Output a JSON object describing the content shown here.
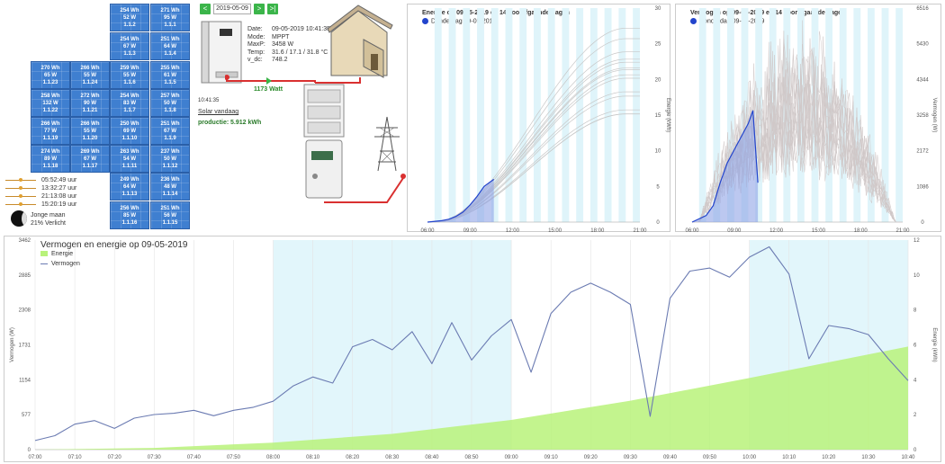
{
  "panels": [
    {
      "wh": "254 Wh",
      "w": "52 W",
      "id": "1.1.2"
    },
    {
      "wh": "271 Wh",
      "w": "95 W",
      "id": "1.1.1"
    },
    {
      "wh": "254 Wh",
      "w": "67 W",
      "id": "1.1.3"
    },
    {
      "wh": "251 Wh",
      "w": "64 W",
      "id": "1.1.4"
    },
    {
      "wh": "270 Wh",
      "w": "65 W",
      "id": "1.1.23"
    },
    {
      "wh": "266 Wh",
      "w": "55 W",
      "id": "1.1.24"
    },
    {
      "wh": "259 Wh",
      "w": "55 W",
      "id": "1.1.6"
    },
    {
      "wh": "255 Wh",
      "w": "61 W",
      "id": "1.1.5"
    },
    {
      "wh": "258 Wh",
      "w": "132 W",
      "id": "1.1.22"
    },
    {
      "wh": "272 Wh",
      "w": "90 W",
      "id": "1.1.21"
    },
    {
      "wh": "254 Wh",
      "w": "83 W",
      "id": "1.1.7"
    },
    {
      "wh": "257 Wh",
      "w": "50 W",
      "id": "1.1.8"
    },
    {
      "wh": "266 Wh",
      "w": "77 W",
      "id": "1.1.19"
    },
    {
      "wh": "266 Wh",
      "w": "55 W",
      "id": "1.1.20"
    },
    {
      "wh": "250 Wh",
      "w": "69 W",
      "id": "1.1.10"
    },
    {
      "wh": "251 Wh",
      "w": "67 W",
      "id": "1.1.9"
    },
    {
      "wh": "274 Wh",
      "w": "89 W",
      "id": "1.1.18"
    },
    {
      "wh": "269 Wh",
      "w": "67 W",
      "id": "1.1.17"
    },
    {
      "wh": "263 Wh",
      "w": "54 W",
      "id": "1.1.11"
    },
    {
      "wh": "237 Wh",
      "w": "50 W",
      "id": "1.1.12"
    },
    {
      "wh": "249 Wh",
      "w": "64 W",
      "id": "1.1.13"
    },
    {
      "wh": "236 Wh",
      "w": "48 W",
      "id": "1.1.14"
    },
    {
      "wh": "256 Wh",
      "w": "85 W",
      "id": "1.1.16"
    },
    {
      "wh": "251 Wh",
      "w": "56 W",
      "id": "1.1.15"
    }
  ],
  "sun": {
    "sunrise": "05:52:49 uur",
    "noon": "13:32:27 uur",
    "sunset": "21:13:08 uur",
    "daylength": "15:20:19 uur",
    "moon_phase": "Jonge maan",
    "moon_lit": "21% Verlicht"
  },
  "date_nav": {
    "prev": "<",
    "date": "2019-05-09",
    "next": ">",
    "last": ">|"
  },
  "inverter": {
    "date_label": "Date:",
    "date_value": "09-05-2019 10:41:35",
    "mode_label": "Mode:",
    "mode_value": "MPPT",
    "maxp_label": "MaxP:",
    "maxp_value": "3458 W",
    "temp_label": "Temp:",
    "temp_value": "31.6 / 17.1 / 31.8 °C",
    "vdc_label": "v_dc:",
    "vdc_value": "748.2",
    "time": "10:41:35",
    "power_flow": "1173 Watt",
    "solar_link": "Solar vandaag",
    "production_label": "productie:",
    "production_value": "5.912 kWh"
  },
  "chart_data": [
    {
      "type": "line",
      "title": "Energie op 09-05-2019 en 14 voorafgaande dagen",
      "legend": [
        "Donderdag 09-05-2019"
      ],
      "ylabel": "Energie (kWh)",
      "xticks": [
        "06:00",
        "09:00",
        "12:00",
        "15:00",
        "18:00",
        "21:00"
      ],
      "yticks": [
        "0",
        "5",
        "10",
        "15",
        "20",
        "25",
        "30"
      ],
      "ylim": [
        0,
        30
      ],
      "series": [
        {
          "name": "Donderdag 09-05-2019",
          "x": [
            "06:00",
            "07:00",
            "07:30",
            "08:00",
            "08:30",
            "09:00",
            "09:30",
            "10:00",
            "10:41"
          ],
          "values": [
            0,
            0.2,
            0.4,
            0.8,
            1.4,
            2.4,
            3.6,
            5.0,
            6.0
          ]
        }
      ]
    },
    {
      "type": "line",
      "title": "Vermogen op 09-05-2019 en 14 voorafgaande dagen",
      "legend": [
        "Donderdag 09-05-2019"
      ],
      "ylabel": "Vermogen (W)",
      "xticks": [
        "06:00",
        "09:00",
        "12:00",
        "15:00",
        "18:00",
        "21:00"
      ],
      "yticks": [
        "0",
        "1086",
        "2172",
        "3258",
        "4344",
        "5430",
        "6516"
      ],
      "ylim": [
        0,
        6516
      ],
      "series": [
        {
          "name": "Donderdag 09-05-2019",
          "x": [
            "06:00",
            "07:00",
            "07:30",
            "08:00",
            "08:30",
            "09:00",
            "09:30",
            "10:00",
            "10:20",
            "10:41"
          ],
          "values": [
            0,
            200,
            500,
            1200,
            1800,
            2200,
            2600,
            3000,
            3400,
            1200
          ]
        }
      ]
    },
    {
      "type": "area",
      "title": "Vermogen en energie op 09-05-2019",
      "legend": [
        "Energie",
        "Vermogen"
      ],
      "ylabel_left": "Vermogen (W)",
      "ylabel_right": "Energie (kWh)",
      "xticks": [
        "07:00",
        "07:10",
        "07:20",
        "07:30",
        "07:40",
        "07:50",
        "08:00",
        "08:10",
        "08:20",
        "08:30",
        "08:40",
        "08:50",
        "09:00",
        "09:10",
        "09:20",
        "09:30",
        "09:40",
        "09:50",
        "10:00",
        "10:10",
        "10:20",
        "10:30",
        "10:40"
      ],
      "yticks_left": [
        "0",
        "577",
        "1154",
        "1731",
        "2308",
        "2885",
        "3462"
      ],
      "yticks_right": [
        "0",
        "2",
        "4",
        "6",
        "8",
        "10",
        "12"
      ],
      "ylim_left": [
        0,
        3462
      ],
      "ylim_right": [
        0,
        12
      ],
      "series": [
        {
          "name": "Vermogen",
          "axis": "left",
          "x": [
            0,
            5,
            10,
            15,
            20,
            25,
            30,
            35,
            40,
            45,
            50,
            55,
            60,
            65,
            70,
            75,
            80,
            85,
            90,
            95,
            100,
            105,
            110,
            115,
            120,
            125,
            130,
            135,
            140,
            145,
            150,
            155,
            160,
            165,
            170,
            175,
            180,
            185,
            190,
            195,
            200,
            205,
            210,
            215,
            220
          ],
          "values": [
            150,
            230,
            420,
            480,
            350,
            520,
            580,
            600,
            650,
            560,
            650,
            700,
            800,
            1050,
            1200,
            1100,
            1700,
            1820,
            1650,
            1950,
            1420,
            2100,
            1480,
            1880,
            2150,
            1280,
            2250,
            2600,
            2750,
            2600,
            2400,
            550,
            2500,
            2950,
            3000,
            2850,
            3180,
            3350,
            2900,
            1500,
            2050,
            2000,
            1900,
            1500,
            1140
          ]
        },
        {
          "name": "Energie",
          "axis": "right",
          "x": [
            0,
            30,
            60,
            90,
            120,
            150,
            180,
            200,
            220
          ],
          "values": [
            0,
            0.1,
            0.4,
            0.9,
            1.7,
            2.8,
            4.1,
            5.0,
            5.9
          ]
        }
      ]
    }
  ]
}
